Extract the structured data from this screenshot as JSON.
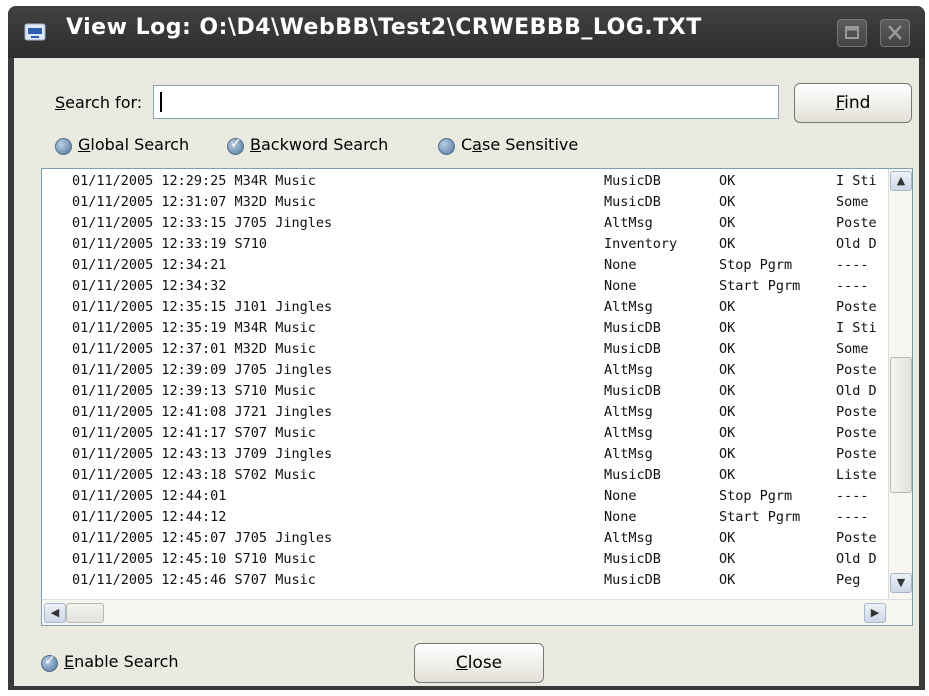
{
  "window": {
    "title": "View Log: O:\\D4\\WebBB\\Test2\\CRWEBBB_LOG.TXT"
  },
  "search": {
    "label_prefix": "S",
    "label_rest": "earch for:",
    "value": "",
    "find_prefix": "F",
    "find_rest": "ind"
  },
  "options": [
    {
      "prefix": "G",
      "rest": "lobal Search",
      "checked": false
    },
    {
      "prefix": "B",
      "rest": "ackword Search",
      "checked": true
    },
    {
      "prefix": "C",
      "mid": "a",
      "rest": "se Sensitive",
      "checked": false
    }
  ],
  "log": [
    {
      "datetime": "01/11/2005 12:29:25 M34R Music",
      "source": "MusicDB",
      "status": "OK",
      "desc": "I Sti"
    },
    {
      "datetime": "01/11/2005 12:31:07 M32D Music",
      "source": "MusicDB",
      "status": "OK",
      "desc": "Some"
    },
    {
      "datetime": "01/11/2005 12:33:15 J705 Jingles",
      "source": "AltMsg",
      "status": "OK",
      "desc": "Poste"
    },
    {
      "datetime": "01/11/2005 12:33:19 S710",
      "source": "Inventory",
      "status": "OK",
      "desc": "Old D"
    },
    {
      "datetime": "01/11/2005 12:34:21",
      "source": "None",
      "status": "Stop Pgrm",
      "desc": "----"
    },
    {
      "datetime": "01/11/2005 12:34:32",
      "source": "None",
      "status": "Start Pgrm",
      "desc": "----"
    },
    {
      "datetime": "01/11/2005 12:35:15 J101 Jingles",
      "source": "AltMsg",
      "status": "OK",
      "desc": "Poste"
    },
    {
      "datetime": "01/11/2005 12:35:19 M34R Music",
      "source": "MusicDB",
      "status": "OK",
      "desc": "I Sti"
    },
    {
      "datetime": "01/11/2005 12:37:01 M32D Music",
      "source": "MusicDB",
      "status": "OK",
      "desc": "Some"
    },
    {
      "datetime": "01/11/2005 12:39:09 J705 Jingles",
      "source": "AltMsg",
      "status": "OK",
      "desc": "Poste"
    },
    {
      "datetime": "01/11/2005 12:39:13 S710 Music",
      "source": "MusicDB",
      "status": "OK",
      "desc": "Old D"
    },
    {
      "datetime": "01/11/2005 12:41:08 J721 Jingles",
      "source": "AltMsg",
      "status": "OK",
      "desc": "Poste"
    },
    {
      "datetime": "01/11/2005 12:41:17 S707 Music",
      "source": "AltMsg",
      "status": "OK",
      "desc": "Poste"
    },
    {
      "datetime": "01/11/2005 12:43:13 J709 Jingles",
      "source": "AltMsg",
      "status": "OK",
      "desc": "Poste"
    },
    {
      "datetime": "01/11/2005 12:43:18 S702 Music",
      "source": "MusicDB",
      "status": "OK",
      "desc": "Liste"
    },
    {
      "datetime": "01/11/2005 12:44:01",
      "source": "None",
      "status": "Stop Pgrm",
      "desc": "----"
    },
    {
      "datetime": "01/11/2005 12:44:12",
      "source": "None",
      "status": "Start Pgrm",
      "desc": "----"
    },
    {
      "datetime": "01/11/2005 12:45:07 J705 Jingles",
      "source": "AltMsg",
      "status": "OK",
      "desc": "Poste"
    },
    {
      "datetime": "01/11/2005 12:45:10 S710 Music",
      "source": "MusicDB",
      "status": "OK",
      "desc": "Old D"
    },
    {
      "datetime": "01/11/2005 12:45:46 S707 Music",
      "source": "MusicDB",
      "status": "OK",
      "desc": "Peg"
    }
  ],
  "enable_search": {
    "prefix": "E",
    "rest": "nable Search",
    "checked": true
  },
  "close_button": {
    "prefix": "C",
    "rest": "lose"
  },
  "colors": {
    "title_bar": "#2d2d2d",
    "dialog_bg": "#ebeae1",
    "radio_blue": "#4f7499"
  }
}
